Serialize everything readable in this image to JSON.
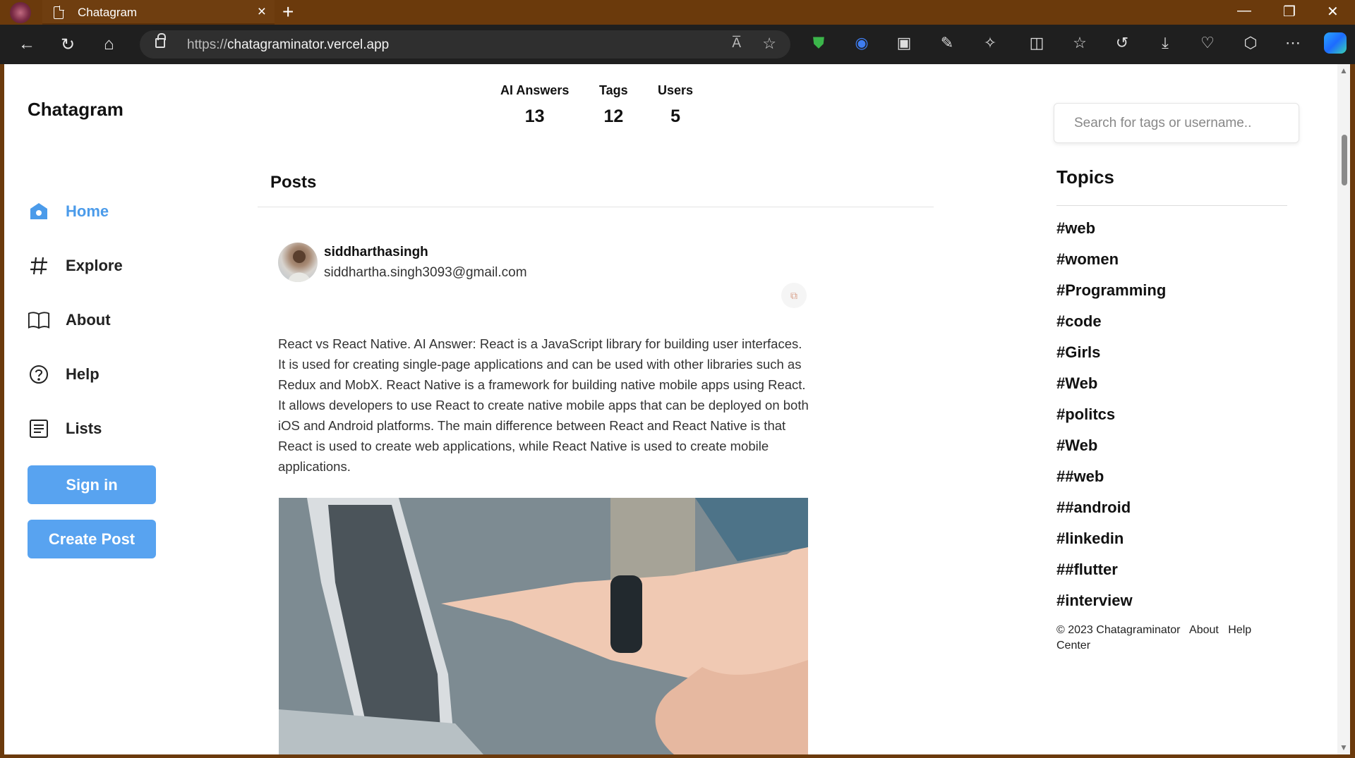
{
  "browser": {
    "tab_title": "Chatagram",
    "url_scheme": "https://",
    "url_host": "chatagraminator.vercel.app",
    "read_aloud": "A̅",
    "new_tab": "+"
  },
  "app": {
    "brand": "Chatagram"
  },
  "sidebar": {
    "items": [
      {
        "label": "Home",
        "icon": "home-icon",
        "active": true
      },
      {
        "label": "Explore",
        "icon": "hash-icon"
      },
      {
        "label": "About",
        "icon": "book-icon"
      },
      {
        "label": "Help",
        "icon": "help-icon"
      },
      {
        "label": "Lists",
        "icon": "list-icon"
      }
    ],
    "sign_in": "Sign in",
    "create_post": "Create Post"
  },
  "stats": [
    {
      "label": "AI Answers",
      "value": "13"
    },
    {
      "label": "Tags",
      "value": "12"
    },
    {
      "label": "Users",
      "value": "5"
    }
  ],
  "posts": {
    "heading": "Posts",
    "items": [
      {
        "username": "siddharthasingh",
        "email": "siddhartha.singh3093@gmail.com",
        "text": "React vs React Native. AI Answer: React is a JavaScript library for building user interfaces. It is used for creating single-page applications and can be used with other libraries such as Redux and MobX. React Native is a framework for building native mobile apps using React. It allows developers to use React to create native mobile apps that can be deployed on both iOS and Android platforms. The main difference between React and React Native is that React is used to create web applications, while React Native is used to create mobile applications."
      }
    ]
  },
  "search": {
    "placeholder": "Search for tags or username.."
  },
  "topics": {
    "heading": "Topics",
    "items": [
      "#web",
      "#women",
      "#Programming",
      "#code",
      "#Girls",
      "#Web",
      "#politcs",
      "#Web",
      "##web",
      "##android",
      "#linkedin",
      "##flutter",
      "#interview"
    ]
  },
  "footer": {
    "copyright": "© 2023 Chatagraminator",
    "about": "About",
    "help_center": "Help Center"
  },
  "colors": {
    "accent": "#58a3f0",
    "active_nav": "#4b9bea",
    "browser_frame": "#6b3a0c"
  }
}
